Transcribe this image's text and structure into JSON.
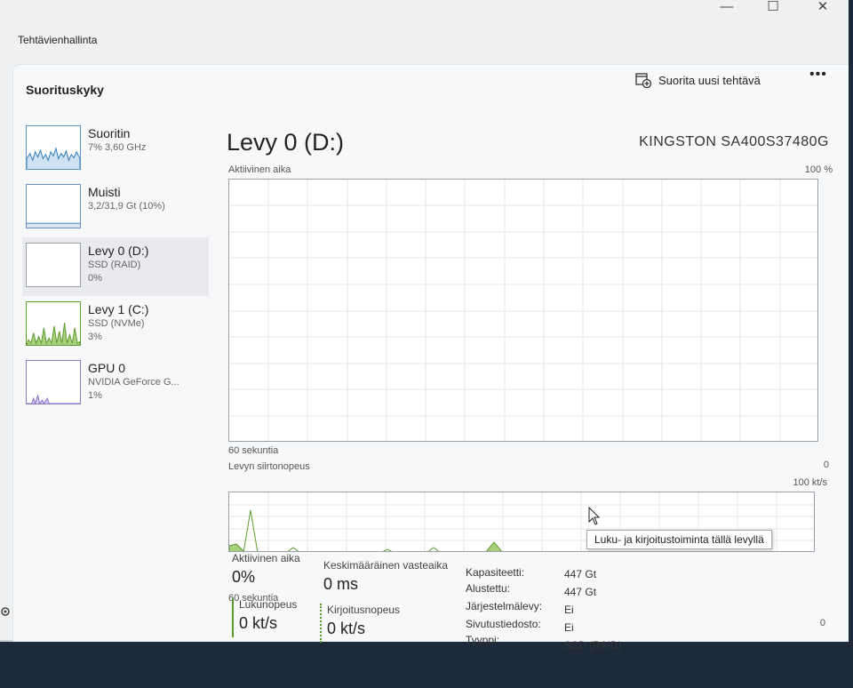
{
  "window": {
    "app_title": "Tehtävienhallinta",
    "minimize": "—",
    "maximize": "☐",
    "close": "✕"
  },
  "header": {
    "section_title": "Suorituskyky",
    "run_task_label": "Suorita uusi tehtävä",
    "more_label": "•••"
  },
  "sidebar": {
    "items": [
      {
        "name": "Suoritin",
        "sub1": "7% 3,60 GHz",
        "sub2": ""
      },
      {
        "name": "Muisti",
        "sub1": "3,2/31,9 Gt (10%)",
        "sub2": ""
      },
      {
        "name": "Levy 0 (D:)",
        "sub1": "SSD (RAID)",
        "sub2": "0%"
      },
      {
        "name": "Levy 1 (C:)",
        "sub1": "SSD (NVMe)",
        "sub2": "3%"
      },
      {
        "name": "GPU 0",
        "sub1": "NVIDIA GeForce G...",
        "sub2": "1%"
      }
    ]
  },
  "main": {
    "title": "Levy 0 (D:)",
    "model": "KINGSTON SA400S37480G",
    "active_time_graph": {
      "label": "Aktiivinen aika",
      "max_label": "100 %",
      "time_label": "60 sekuntia",
      "min_label": "0"
    },
    "transfer_graph": {
      "label": "Levyn siirtonopeus",
      "max_label": "100 kt/s",
      "time_label": "60 sekuntia",
      "min_label": "0"
    },
    "stats": {
      "active_time_label": "Aktiivinen aika",
      "active_time_value": "0%",
      "response_label": "Keskimääräinen vasteaika",
      "response_value": "0 ms",
      "read_label": "Lukunopeus",
      "read_value": "0 kt/s",
      "write_label": "Kirjoitusnopeus",
      "write_value": "0 kt/s"
    },
    "details": [
      {
        "key": "Kapasiteetti:",
        "value": "447 Gt"
      },
      {
        "key": "Alustettu:",
        "value": "447 Gt"
      },
      {
        "key": "Järjestelmälevy:",
        "value": "Ei"
      },
      {
        "key": "Sivutustiedosto:",
        "value": "Ei"
      },
      {
        "key": "Tyyppi:",
        "value": "SSD (RAID)"
      }
    ],
    "tooltip": "Luku- ja kirjoitustoiminta tällä levyllä"
  },
  "colors": {
    "accent_green": "#5a9a2e",
    "cpu_blue": "#2a7ab8",
    "gpu_purple": "#8a6ac8"
  }
}
